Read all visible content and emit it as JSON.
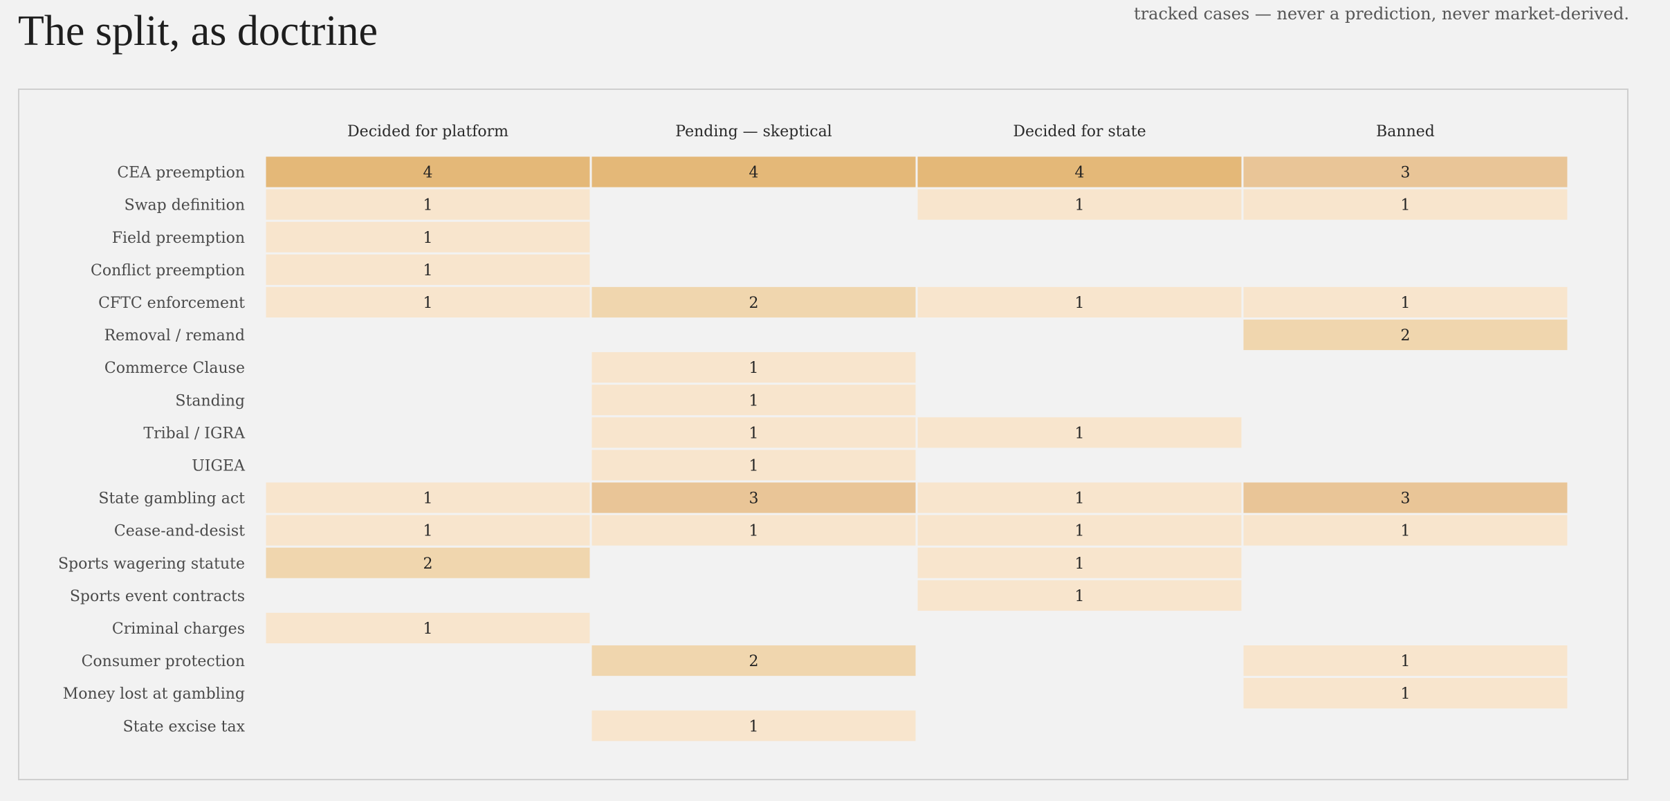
{
  "page": {
    "title": "The split, as doctrine",
    "note": "tracked cases — never a prediction, never market-derived."
  },
  "colors": {
    "background": "#f2f2f2",
    "scale": [
      "#f8e5cd",
      "#f0d6ae",
      "#e9c597",
      "#e4b878"
    ]
  },
  "chart_data": {
    "type": "heatmap",
    "columns": [
      "Decided for platform",
      "Pending — skeptical",
      "Decided for state",
      "Banned"
    ],
    "rows": [
      "CEA preemption",
      "Swap definition",
      "Field preemption",
      "Conflict preemption",
      "CFTC enforcement",
      "Removal / remand",
      "Commerce Clause",
      "Standing",
      "Tribal / IGRA",
      "UIGEA",
      "State gambling act",
      "Cease-and-desist",
      "Sports wagering statute",
      "Sports event contracts",
      "Criminal charges",
      "Consumer protection",
      "Money lost at gambling",
      "State excise tax"
    ],
    "values": [
      [
        4,
        4,
        4,
        3
      ],
      [
        1,
        null,
        1,
        1
      ],
      [
        1,
        null,
        null,
        null
      ],
      [
        1,
        null,
        null,
        null
      ],
      [
        1,
        2,
        1,
        1
      ],
      [
        null,
        null,
        null,
        2
      ],
      [
        null,
        1,
        null,
        null
      ],
      [
        null,
        1,
        null,
        null
      ],
      [
        null,
        1,
        1,
        null
      ],
      [
        null,
        1,
        null,
        null
      ],
      [
        1,
        3,
        1,
        3
      ],
      [
        1,
        1,
        1,
        1
      ],
      [
        2,
        null,
        1,
        null
      ],
      [
        null,
        null,
        1,
        null
      ],
      [
        1,
        null,
        null,
        null
      ],
      [
        null,
        2,
        null,
        1
      ],
      [
        null,
        null,
        null,
        1
      ],
      [
        null,
        1,
        null,
        null
      ]
    ]
  }
}
